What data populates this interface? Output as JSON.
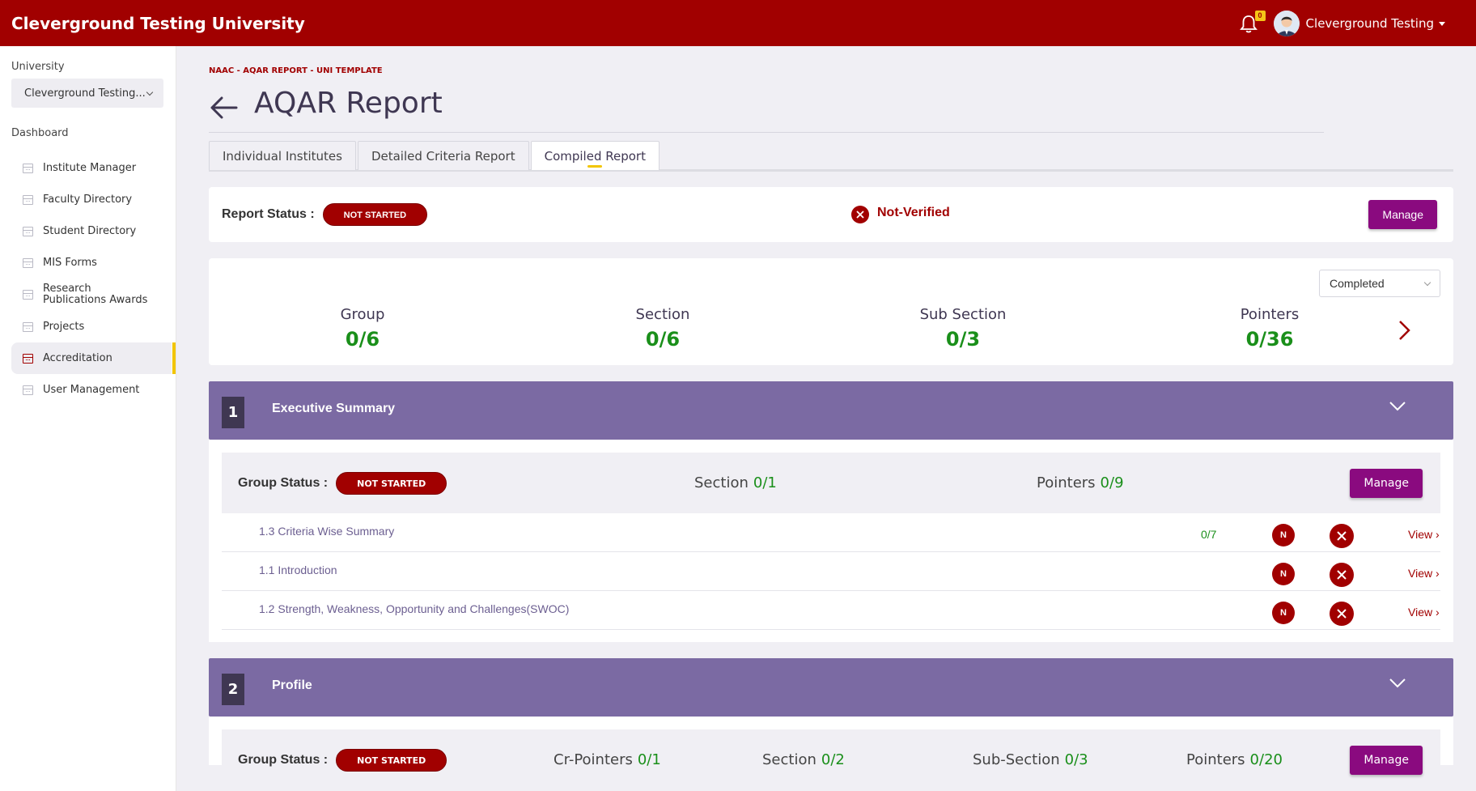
{
  "app": {
    "title": "Cleverground Testing University",
    "notification_count": "0",
    "user_name": "Cleverground Testing"
  },
  "sidebar": {
    "university_label": "University",
    "university_value": "Cleverground Testing...",
    "dashboard_label": "Dashboard",
    "items": [
      {
        "label": "Institute Manager"
      },
      {
        "label": "Faculty Directory"
      },
      {
        "label": "Student Directory"
      },
      {
        "label": "MIS Forms"
      },
      {
        "label": "Research Publications Awards"
      },
      {
        "label": "Projects"
      },
      {
        "label": "Accreditation",
        "active": true
      },
      {
        "label": "User Management"
      }
    ]
  },
  "page": {
    "breadcrumb": "NAAC - AQAR REPORT - UNI TEMPLATE",
    "title": "AQAR Report",
    "tabs": [
      {
        "label": "Individual Institutes"
      },
      {
        "label": "Detailed Criteria Report"
      },
      {
        "label": "Compiled Report",
        "active": true
      }
    ]
  },
  "report_status": {
    "label": "Report Status :",
    "status": "NOT STARTED",
    "verification": "Not-Verified",
    "manage_label": "Manage"
  },
  "stats": {
    "filter_value": "Completed",
    "items": [
      {
        "label": "Group",
        "value": "0/6"
      },
      {
        "label": "Section",
        "value": "0/6"
      },
      {
        "label": "Sub Section",
        "value": "0/3"
      },
      {
        "label": "Pointers",
        "value": "0/36"
      }
    ]
  },
  "groups": [
    {
      "number": "1",
      "name": "Executive Summary",
      "status_label": "Group Status :",
      "status": "NOT STARTED",
      "section_label": "Section",
      "section_value": "0/1",
      "pointers_label": "Pointers",
      "pointers_value": "0/9",
      "manage_label": "Manage",
      "rows": [
        {
          "name": "1.3 Criteria Wise Summary",
          "count": "0/7",
          "badge": "N",
          "view": "View"
        },
        {
          "name": "1.1 Introduction",
          "count": "",
          "badge": "N",
          "view": "View"
        },
        {
          "name": "1.2 Strength, Weakness, Opportunity and Challenges(SWOC)",
          "count": "",
          "badge": "N",
          "view": "View"
        }
      ]
    },
    {
      "number": "2",
      "name": "Profile",
      "status_label": "Group Status :",
      "status": "NOT STARTED",
      "cr_pointers_label": "Cr-Pointers",
      "cr_pointers_value": "0/1",
      "section_label": "Section",
      "section_value": "0/2",
      "subsection_label": "Sub-Section",
      "subsection_value": "0/3",
      "pointers_label": "Pointers",
      "pointers_value": "0/20",
      "manage_label": "Manage"
    }
  ],
  "colors": {
    "brand": "#a10000",
    "group_header": "#7b6aa3",
    "manage_button": "#8a0a7f",
    "accent": "#f2c500",
    "success": "#1a8f1a"
  }
}
